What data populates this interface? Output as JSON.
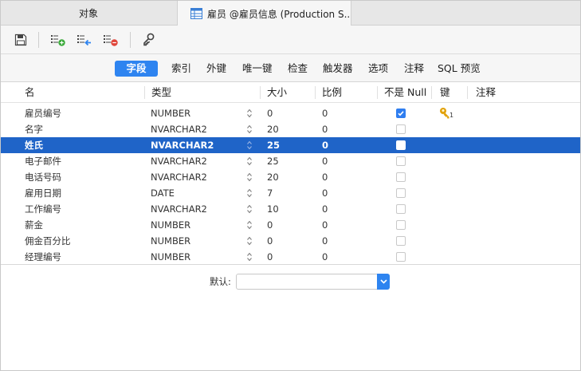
{
  "tabs": {
    "objects_label": "对象",
    "active_label": "雇员 @雇员信息 (Production S..."
  },
  "toolbar": {
    "icons": [
      "save-icon",
      "add-field-icon",
      "insert-field-icon",
      "delete-field-icon",
      "primary-key-icon"
    ]
  },
  "subtabs": [
    "字段",
    "索引",
    "外键",
    "唯一键",
    "检查",
    "触发器",
    "选项",
    "注释",
    "SQL 预览"
  ],
  "columns": {
    "name": "名",
    "type": "类型",
    "size": "大小",
    "scale": "比例",
    "not_null": "不是 Null",
    "key": "键",
    "comment": "注释"
  },
  "rows": [
    {
      "name": "雇员编号",
      "type": "NUMBER",
      "size": "0",
      "scale": "0",
      "not_null": true,
      "key": "1"
    },
    {
      "name": "名字",
      "type": "NVARCHAR2",
      "size": "20",
      "scale": "0",
      "not_null": false,
      "key": ""
    },
    {
      "name": "姓氏",
      "type": "NVARCHAR2",
      "size": "25",
      "scale": "0",
      "not_null": false,
      "key": "",
      "selected": true
    },
    {
      "name": "电子邮件",
      "type": "NVARCHAR2",
      "size": "25",
      "scale": "0",
      "not_null": false,
      "key": ""
    },
    {
      "name": "电话号码",
      "type": "NVARCHAR2",
      "size": "20",
      "scale": "0",
      "not_null": false,
      "key": ""
    },
    {
      "name": "雇用日期",
      "type": "DATE",
      "size": "7",
      "scale": "0",
      "not_null": false,
      "key": ""
    },
    {
      "name": "工作编号",
      "type": "NVARCHAR2",
      "size": "10",
      "scale": "0",
      "not_null": false,
      "key": ""
    },
    {
      "name": "薪金",
      "type": "NUMBER",
      "size": "0",
      "scale": "0",
      "not_null": false,
      "key": ""
    },
    {
      "name": "佣金百分比",
      "type": "NUMBER",
      "size": "0",
      "scale": "0",
      "not_null": false,
      "key": ""
    },
    {
      "name": "经理编号",
      "type": "NUMBER",
      "size": "0",
      "scale": "0",
      "not_null": false,
      "key": ""
    }
  ],
  "default_field": {
    "label": "默认:",
    "value": ""
  },
  "colors": {
    "accent": "#2e84f0",
    "selection": "#1f64c8",
    "key_icon": "#e2a20c"
  }
}
